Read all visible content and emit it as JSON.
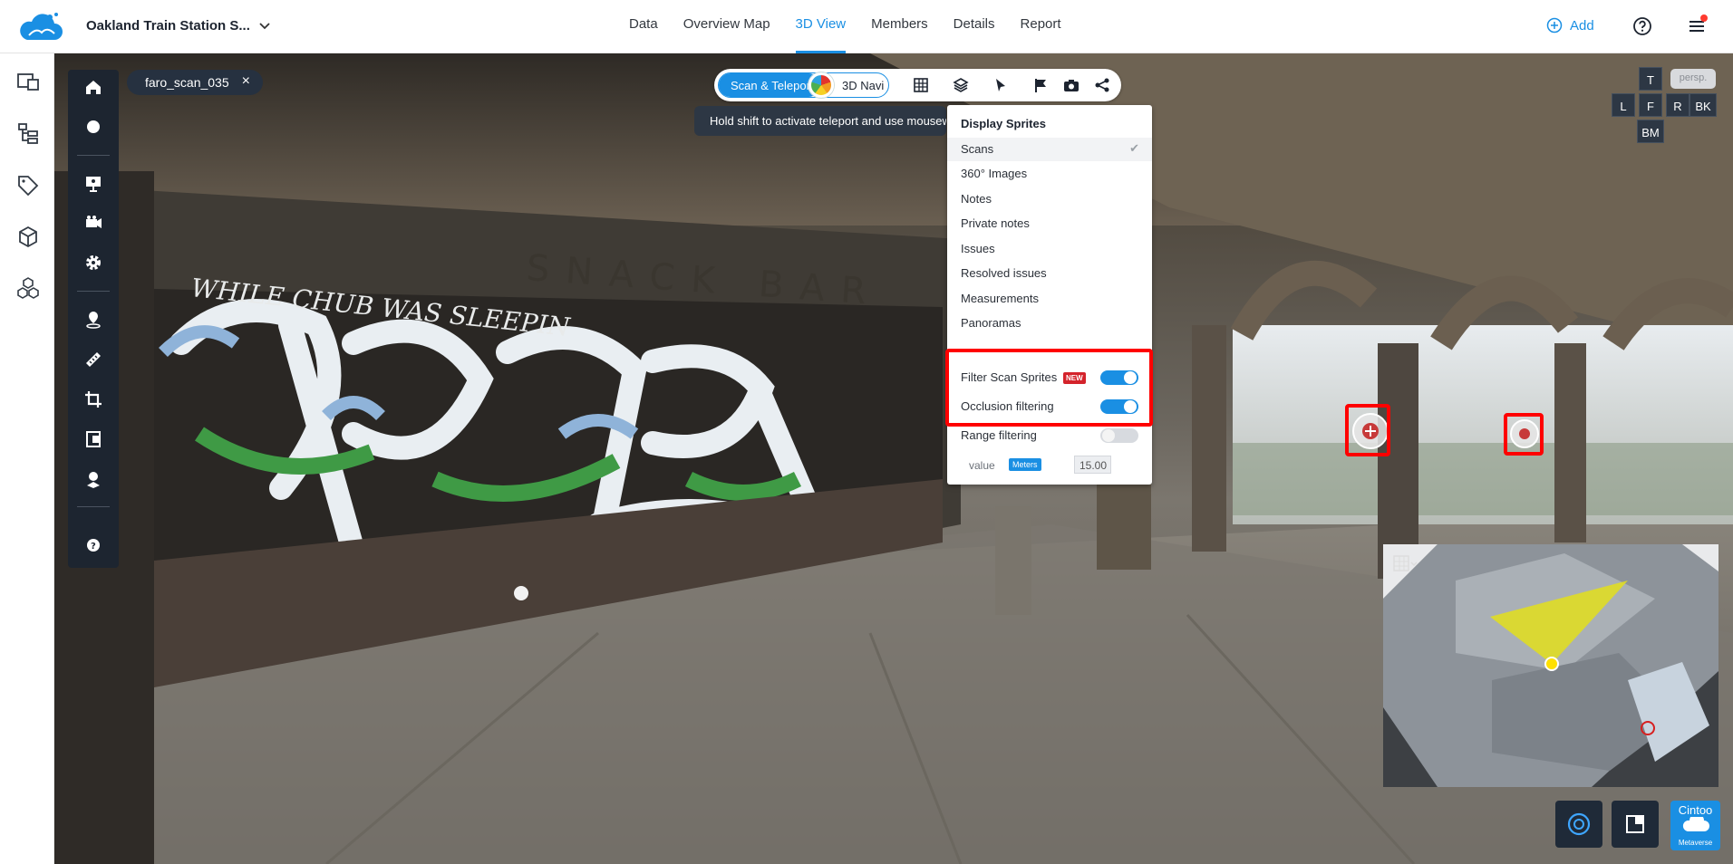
{
  "topbar": {
    "project_name": "Oakland Train Station S...",
    "tabs": [
      {
        "label": "Data"
      },
      {
        "label": "Overview Map"
      },
      {
        "label": "3D View",
        "active": true
      },
      {
        "label": "Members"
      },
      {
        "label": "Details"
      },
      {
        "label": "Report"
      }
    ],
    "add_label": "Add",
    "accent_color": "#1a8fe3"
  },
  "left_rail": {
    "icons": [
      "projects-icon",
      "hierarchy-icon",
      "tag-icon",
      "cube-icon",
      "cubes-icon"
    ]
  },
  "viewer": {
    "scan_chip": {
      "label": "faro_scan_035"
    },
    "mode": {
      "scan_teleport_label": "Scan & Teleport",
      "navi_label": "3D Navi",
      "tools": [
        "grid-icon",
        "layers-icon",
        "pointer-icon",
        "flag-icon",
        "camera-icon",
        "share-icon"
      ]
    },
    "hint": "Hold shift to activate teleport and use mousewheel",
    "tool_panel": {
      "tools": [
        "home-icon",
        "sphere-icon",
        "presentation-icon",
        "camera-video-icon",
        "gear-icon",
        "location-pin-icon",
        "ruler-icon",
        "crop-icon",
        "clipping-icon",
        "scan-station-icon",
        "help-icon"
      ]
    },
    "view_cube": {
      "persp_label": "persp.",
      "top": "T",
      "left": "L",
      "front": "F",
      "right": "R",
      "back": "BK",
      "bottom": "BM"
    },
    "metaverse": {
      "top": "Cintoo",
      "bottom": "Metaverse"
    }
  },
  "sprite_menu": {
    "title": "Display Sprites",
    "items": [
      {
        "label": "Scans",
        "checked": true
      },
      {
        "label": "360° Images"
      },
      {
        "label": "Notes"
      },
      {
        "label": "Private notes"
      },
      {
        "label": "Issues"
      },
      {
        "label": "Resolved issues"
      },
      {
        "label": "Measurements"
      },
      {
        "label": "Panoramas"
      }
    ],
    "filter_scan_sprites": {
      "label": "Filter Scan Sprites",
      "badge": "NEW",
      "on": true
    },
    "occlusion_filtering": {
      "label": "Occlusion filtering",
      "on": true
    },
    "range_filtering": {
      "label": "Range filtering",
      "on": false
    },
    "range_value": {
      "label": "value",
      "unit": "Meters",
      "value": "15.00"
    }
  },
  "scene_text": {
    "sign": "SNACK BAR",
    "graffiti": "WHILE CHUB WAS SLEEPIN"
  }
}
